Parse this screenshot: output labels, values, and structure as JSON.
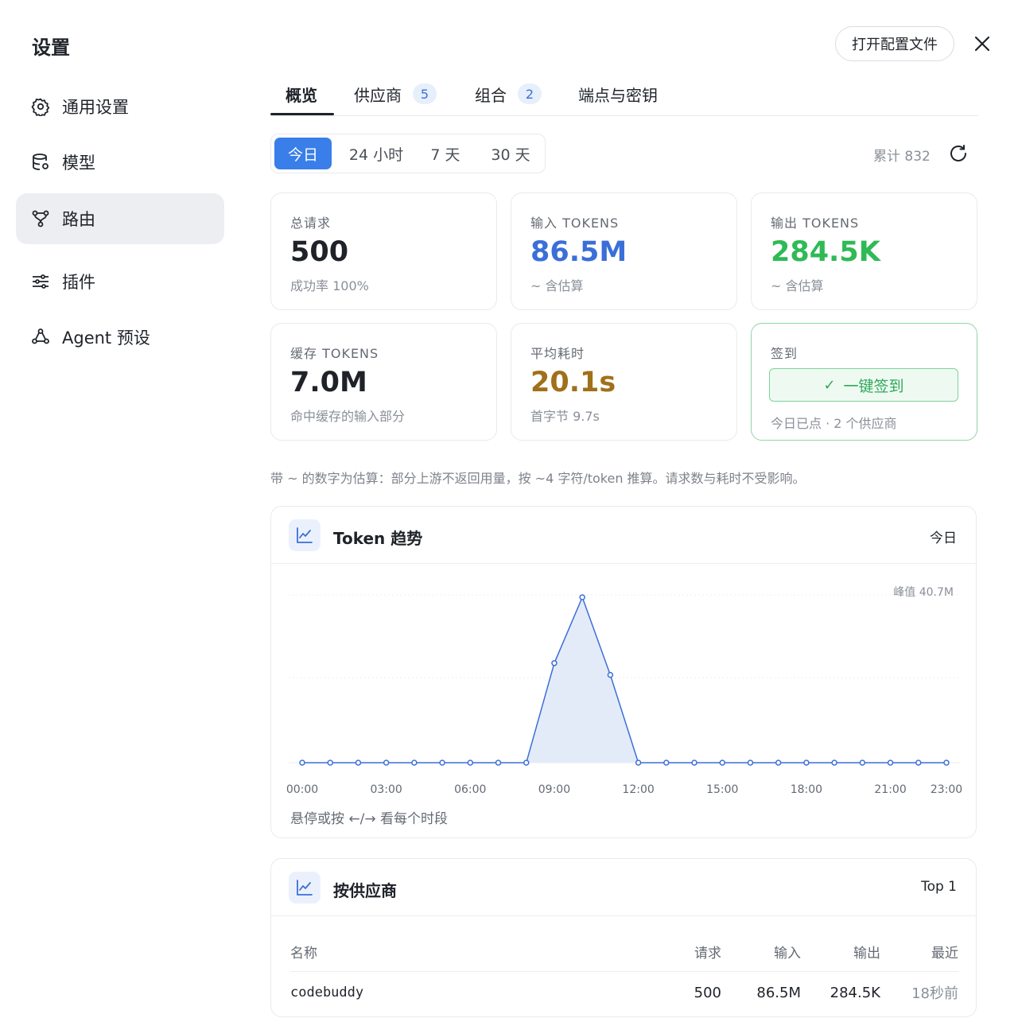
{
  "header": {
    "title": "设置",
    "open_config_label": "打开配置文件"
  },
  "sidebar": {
    "items": [
      {
        "label": "通用设置",
        "icon": "gear-icon"
      },
      {
        "label": "模型",
        "icon": "database-icon"
      },
      {
        "label": "路由",
        "icon": "route-icon",
        "active": true
      },
      {
        "label": "插件",
        "icon": "sliders-icon"
      },
      {
        "label": "Agent 预设",
        "icon": "agent-icon"
      }
    ]
  },
  "tabs": [
    {
      "label": "概览",
      "active": true
    },
    {
      "label": "供应商",
      "count": "5"
    },
    {
      "label": "组合",
      "count": "2"
    },
    {
      "label": "端点与密钥"
    }
  ],
  "ranges": [
    "今日",
    "24 小时",
    "7 天",
    "30 天"
  ],
  "total_label": "累计 832",
  "cards": {
    "requests": {
      "label": "总请求",
      "value": "500",
      "sub": "成功率 100%",
      "color": "#1f2329"
    },
    "input": {
      "label": "输入 TOKENS",
      "value": "86.5M",
      "sub": "~ 含估算",
      "color": "#3b6fd8"
    },
    "output": {
      "label": "输出 TOKENS",
      "value": "284.5K",
      "sub": "~ 含估算",
      "color": "#2fba56"
    },
    "cache": {
      "label": "缓存 TOKENS",
      "value": "7.0M",
      "sub": "命中缓存的输入部分",
      "color": "#1f2329"
    },
    "latency": {
      "label": "平均耗时",
      "value": "20.1s",
      "sub": "首字节 9.7s",
      "color": "#a0701a"
    },
    "checkin": {
      "label": "签到",
      "button": "一键签到",
      "sub": "今日已点 · 2 个供应商"
    }
  },
  "footnote": "带 ~ 的数字为估算：部分上游不返回用量，按 ~4 字符/token 推算。请求数与耗时不受影响。",
  "trend_panel": {
    "title": "Token 趋势",
    "range": "今日",
    "peak_label": "峰值 40.7M",
    "hint": "悬停或按 ←/→ 看每个时段"
  },
  "chart_data": {
    "type": "area",
    "title": "Token 趋势",
    "x": [
      "00:00",
      "01:00",
      "02:00",
      "03:00",
      "04:00",
      "05:00",
      "06:00",
      "07:00",
      "08:00",
      "09:00",
      "10:00",
      "11:00",
      "12:00",
      "13:00",
      "14:00",
      "15:00",
      "16:00",
      "17:00",
      "18:00",
      "19:00",
      "20:00",
      "21:00",
      "22:00",
      "23:00"
    ],
    "values": [
      0,
      0,
      0,
      0,
      0,
      0,
      0,
      0,
      0,
      24.5,
      40.7,
      21.6,
      0,
      0,
      0,
      0,
      0,
      0,
      0,
      0,
      0,
      0,
      0,
      0
    ],
    "unit": "M tokens",
    "tick_labels": [
      "00:00",
      "03:00",
      "06:00",
      "09:00",
      "12:00",
      "15:00",
      "18:00",
      "21:00",
      "23:00"
    ],
    "ylim": [
      0,
      40.7
    ],
    "grid": true,
    "color": "#3b6fd8"
  },
  "provider_panel": {
    "title": "按供应商",
    "right": "Top 1",
    "columns": [
      "名称",
      "请求",
      "输入",
      "输出",
      "最近"
    ],
    "rows": [
      {
        "name": "codebuddy",
        "requests": "500",
        "input": "86.5M",
        "output": "284.5K",
        "recent": "18秒前"
      }
    ]
  }
}
